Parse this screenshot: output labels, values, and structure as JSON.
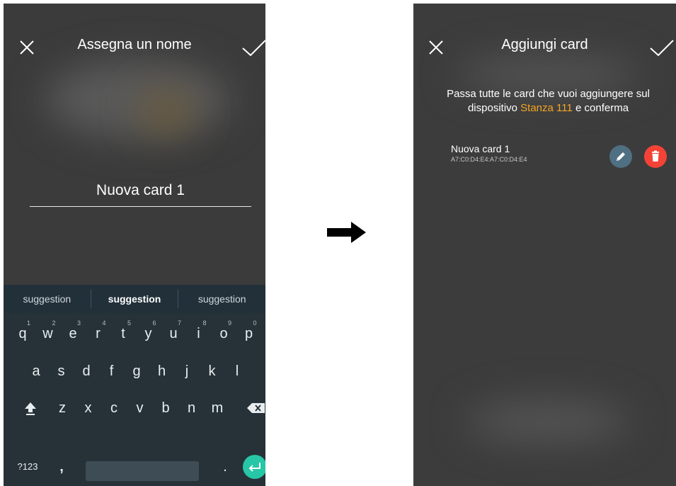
{
  "colors": {
    "accent": "#f5a623",
    "phone_bg": "#3b3b3b",
    "keyboard_bg": "#263238",
    "enter_key": "#26c6a7",
    "edit_button": "#4f7082",
    "delete_button": "#f44336"
  },
  "left_screen": {
    "title": "Assegna un nome",
    "close_icon": "close-icon",
    "confirm_icon": "check-icon",
    "name_value": "Nuova card 1",
    "suggestions": [
      "suggestion",
      "suggestion",
      "suggestion"
    ],
    "keyboard": {
      "row1": [
        {
          "k": "q",
          "h": "1"
        },
        {
          "k": "w",
          "h": "2"
        },
        {
          "k": "e",
          "h": "3"
        },
        {
          "k": "r",
          "h": "4"
        },
        {
          "k": "t",
          "h": "5"
        },
        {
          "k": "y",
          "h": "6"
        },
        {
          "k": "u",
          "h": "7"
        },
        {
          "k": "i",
          "h": "8"
        },
        {
          "k": "o",
          "h": "9"
        },
        {
          "k": "p",
          "h": "0"
        }
      ],
      "row2": [
        "a",
        "s",
        "d",
        "f",
        "g",
        "h",
        "j",
        "k",
        "l"
      ],
      "row3": [
        "z",
        "x",
        "c",
        "v",
        "b",
        "n",
        "m"
      ],
      "symbols_label": "?123",
      "comma": ",",
      "period": ".",
      "shift_icon": "shift-icon",
      "backspace_icon": "backspace-icon",
      "enter_icon": "enter-icon"
    }
  },
  "arrow_icon": "arrow-right-icon",
  "right_screen": {
    "title": "Aggiungi card",
    "close_icon": "close-icon",
    "confirm_icon": "check-icon",
    "instruction_line1": "Passa tutte le card che vuoi aggiungere sul",
    "instruction_pre": "dispositivo ",
    "instruction_device": "Stanza 111",
    "instruction_post": " e conferma",
    "card": {
      "name": "Nuova card 1",
      "mac": "A7:C0:D4:E4:A7:C0:D4:E4",
      "edit_icon": "pencil-icon",
      "delete_icon": "trash-icon"
    }
  }
}
